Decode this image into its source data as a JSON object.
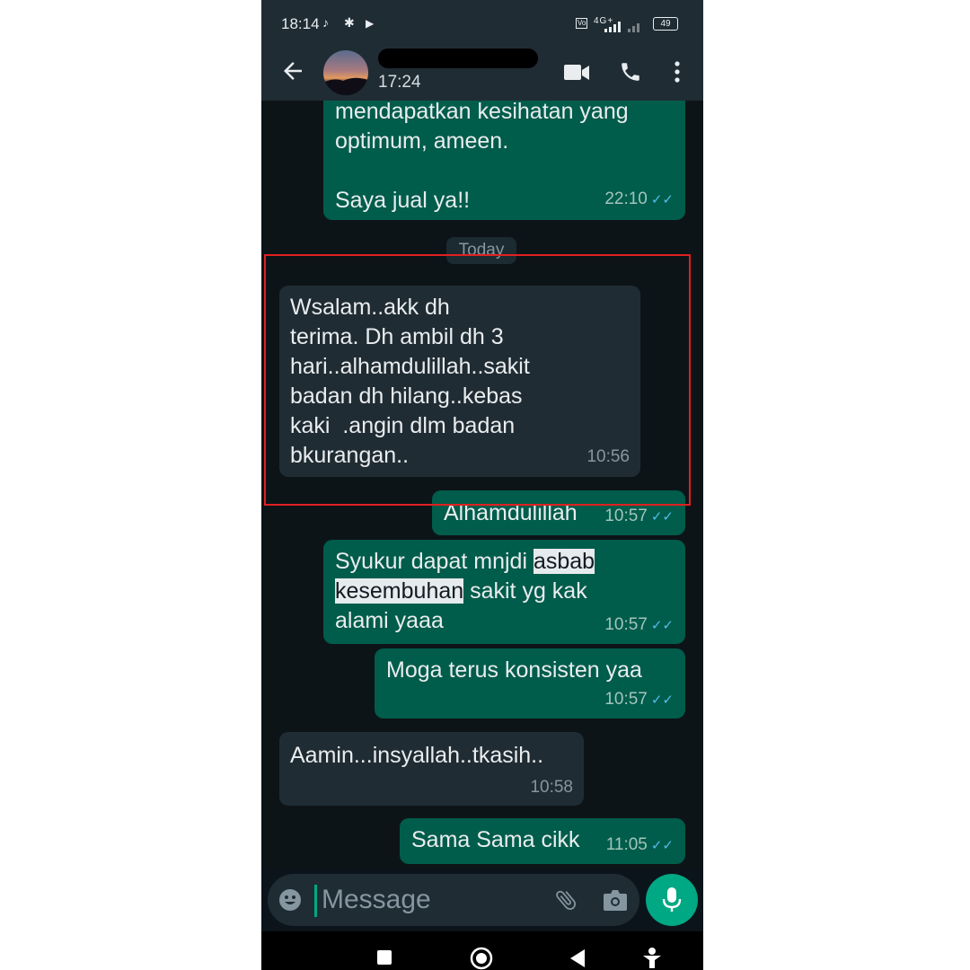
{
  "status_bar": {
    "time": "18:14",
    "network": "4G+",
    "battery": "49",
    "icons": [
      "tiktok-icon",
      "notification-icon",
      "play-icon",
      "volte-icon",
      "signal-icon",
      "battery-icon"
    ]
  },
  "header": {
    "contact_name": "",
    "last_seen": "17:24",
    "icons": [
      "back-arrow-icon",
      "video-call-icon",
      "voice-call-icon",
      "more-vert-icon"
    ]
  },
  "colors": {
    "outgoing_bubble": "#005c4b",
    "incoming_bubble": "#202c33",
    "accent": "#00a884",
    "read_ticks": "#53bdeb",
    "highlight_box": "#e02020"
  },
  "messages": [
    {
      "direction": "out",
      "text": "mendapatkan kesihatan yang\noptimum, ameen.\n\nSaya jual ya!!",
      "time": "22:10",
      "read": true
    },
    {
      "type": "date",
      "text": "Today"
    },
    {
      "direction": "in",
      "text": "Wsalam..akk dh\nterima. Dh ambil dh 3\nhari..alhamdulillah..sakit\nbadan dh hilang..kebas\nkaki  .angin dlm badan\nbkurangan..",
      "time": "10:56",
      "highlighted": true
    },
    {
      "direction": "out",
      "text": "Alhamdulillah",
      "time": "10:57",
      "read": true
    },
    {
      "direction": "out",
      "text_parts": [
        "Syukur dapat mnjdi ",
        "asbab",
        "kesembuhan",
        " sakit yg kak",
        "alami yaaa"
      ],
      "selected_text": "asbab kesembuhan",
      "time": "10:57",
      "read": true
    },
    {
      "direction": "out",
      "text": "Moga terus konsisten yaa",
      "time": "10:57",
      "read": true
    },
    {
      "direction": "in",
      "text": "Aamin...insyallah..tkasih..",
      "time": "10:58"
    },
    {
      "direction": "out",
      "text": "Sama Sama cikk",
      "time": "11:05",
      "read": true
    }
  ],
  "input": {
    "placeholder": "Message",
    "icons": [
      "emoji-icon",
      "attach-icon",
      "camera-icon",
      "mic-icon"
    ]
  },
  "nav": {
    "icons": [
      "recents-square-icon",
      "home-circle-icon",
      "back-triangle-icon",
      "accessibility-icon"
    ]
  }
}
